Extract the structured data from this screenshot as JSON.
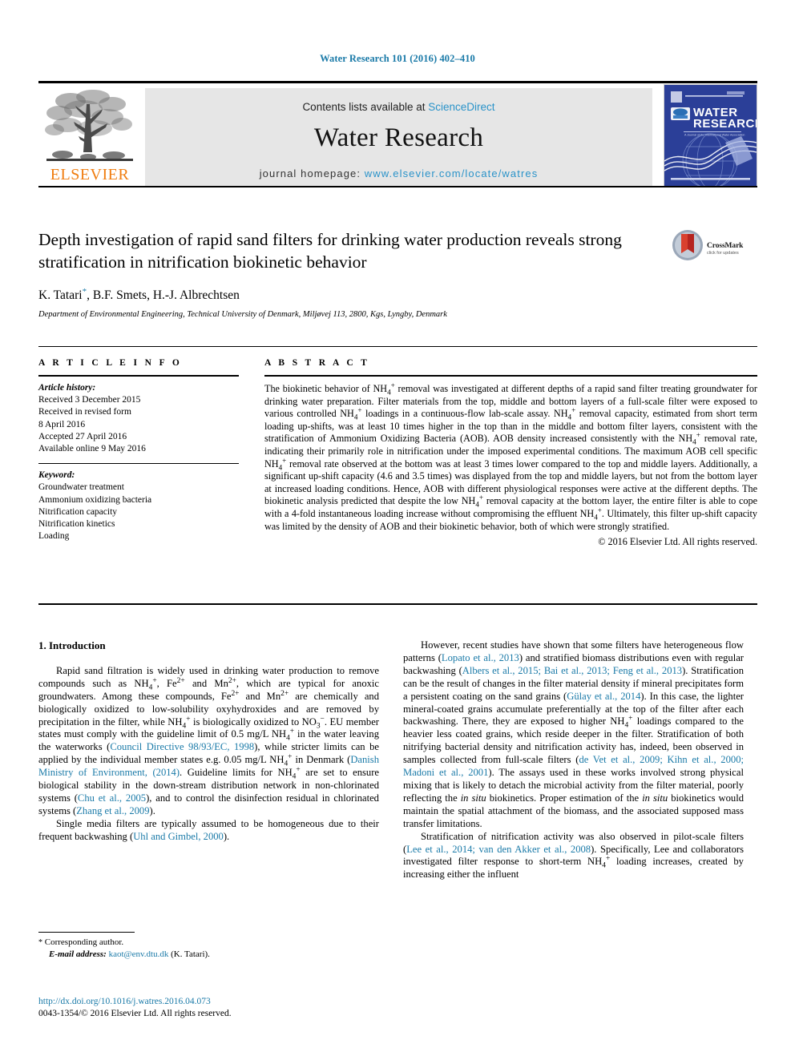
{
  "running_head": "Water Research 101 (2016) 402–410",
  "masthead": {
    "publisher_logo_name": "elsevier-tree-logo",
    "publisher_wordmark": "ELSEVIER",
    "contents_prefix": "Contents lists available at ",
    "contents_link": "ScienceDirect",
    "journal_title": "Water Research",
    "homepage_prefix": "journal homepage: ",
    "homepage_url": "www.elsevier.com/locate/watres",
    "cover_title_line1": "WATER",
    "cover_title_line2": "RESEARCH",
    "cover_bg": "#2b3f98",
    "band_bg": "#e6e6e6",
    "link_color": "#2a93c9"
  },
  "article": {
    "title": "Depth investigation of rapid sand filters for drinking water production reveals strong stratification in nitrification biokinetic behavior",
    "authors": "K. Tatari",
    "authors_rest": ", B.F. Smets, H.-J. Albrechtsen",
    "corresponding_marker": "*",
    "affiliation": "Department of Environmental Engineering, Technical University of Denmark, Miljøvej 113, 2800, Kgs, Lyngby, Denmark",
    "crossmark_label": "CrossMark",
    "crossmark_sub": "click for updates"
  },
  "article_info": {
    "heading": "A R T I C L E   I N F O",
    "history_heading": "Article history:",
    "history_lines": [
      "Received 3 December 2015",
      "Received in revised form",
      "8 April 2016",
      "Accepted 27 April 2016",
      "Available online 9 May 2016"
    ],
    "keyword_heading": "Keyword:",
    "keywords": [
      "Groundwater treatment",
      "Ammonium oxidizing bacteria",
      "Nitrification capacity",
      "Nitrification kinetics",
      "Loading"
    ]
  },
  "abstract": {
    "heading": "A B S T R A C T",
    "paragraph_html": "The biokinetic behavior of NH<sub>4</sub><sup>+</sup> removal was investigated at different depths of a rapid sand filter treating groundwater for drinking water preparation. Filter materials from the top, middle and bottom layers of a full-scale filter were exposed to various controlled NH<sub>4</sub><sup>+</sup> loadings in a continuous-flow lab-scale assay. NH<sub>4</sub><sup>+</sup> removal capacity, estimated from short term loading up-shifts, was at least 10 times higher in the top than in the middle and bottom filter layers, consistent with the stratification of Ammonium Oxidizing Bacteria (AOB). AOB density increased consistently with the NH<sub>4</sub><sup>+</sup> removal rate, indicating their primarily role in nitrification under the imposed experimental conditions. The maximum AOB cell specific NH<sub>4</sub><sup>+</sup> removal rate observed at the bottom was at least 3 times lower compared to the top and middle layers. Additionally, a significant up-shift capacity (4.6 and 3.5 times) was displayed from the top and middle layers, but not from the bottom layer at increased loading conditions. Hence, AOB with different physiological responses were active at the different depths. The biokinetic analysis predicted that despite the low NH<sub>4</sub><sup>+</sup> removal capacity at the bottom layer, the entire filter is able to cope with a 4-fold instantaneous loading increase without compromising the effluent NH<sub>4</sub><sup>+</sup>. Ultimately, this filter up-shift capacity was limited by the density of AOB and their biokinetic behavior, both of which were strongly stratified.",
    "copyright": "© 2016 Elsevier Ltd. All rights reserved."
  },
  "body": {
    "section_number_title": "1.  Introduction",
    "left_paragraphs_html": [
      "Rapid sand filtration is widely used in drinking water production to remove compounds such as NH<sub>4</sub><sup>+</sup>, Fe<sup>2+</sup> and Mn<sup>2+</sup>, which are typical for anoxic groundwaters. Among these compounds, Fe<sup>2+</sup> and Mn<sup>2+</sup> are chemically and biologically oxidized to low-solubility oxyhydroxides and are removed by precipitation in the filter, while NH<sub>4</sub><sup>+</sup> is biologically oxidized to NO<sub>3</sub><sup>−</sup>. EU member states must comply with the guideline limit of 0.5 mg/L NH<sub>4</sub><sup>+</sup> in the water leaving the waterworks (<span class=\"cite\">Council Directive 98/93/EC, 1998</span>), while stricter limits can be applied by the individual member states e.g. 0.05 mg/L NH<sub>4</sub><sup>+</sup> in Denmark (<span class=\"cite\">Danish Ministry of Environment, (2014)</span>. Guideline limits for NH<sub>4</sub><sup>+</sup> are set to ensure biological stability in the down-stream distribution network in non-chlorinated systems (<span class=\"cite\">Chu et al., 2005</span>), and to control the disinfection residual in chlorinated systems (<span class=\"cite\">Zhang et al., 2009</span>).",
      "Single media filters are typically assumed to be homogeneous due to their frequent backwashing (<span class=\"cite\">Uhl and Gimbel, 2000</span>)."
    ],
    "right_paragraphs_html": [
      "However, recent studies have shown that some filters have heterogeneous flow patterns (<span class=\"cite\">Lopato et al., 2013</span>) and stratified biomass distributions even with regular backwashing (<span class=\"cite\">Albers et al., 2015; Bai et al., 2013; Feng et al., 2013</span>). Stratification can be the result of changes in the filter material density if mineral precipitates form a persistent coating on the sand grains (<span class=\"cite\">Gülay et al., 2014</span>). In this case, the lighter mineral-coated grains accumulate preferentially at the top of the filter after each backwashing. There, they are exposed to higher NH<sub>4</sub><sup>+</sup> loadings compared to the heavier less coated grains, which reside deeper in the filter. Stratification of both nitrifying bacterial density and nitrification activity has, indeed, been observed in samples collected from full-scale filters (<span class=\"cite\">de Vet et al., 2009; Kihn et al., 2000; Madoni et al., 2001</span>). The assays used in these works involved strong physical mixing that is likely to detach the microbial activity from the filter material, poorly reflecting the <i>in situ</i> biokinetics. Proper estimation of the <i>in situ</i> biokinetics would maintain the spatial attachment of the biomass, and the associated supposed mass transfer limitations.",
      "Stratification of nitrification activity was also observed in pilot-scale filters (<span class=\"cite\">Lee et al., 2014; van den Akker et al., 2008</span>). Specifically, Lee and collaborators investigated filter response to short-term NH<sub>4</sub><sup>+</sup> loading increases, created by increasing either the influent"
    ]
  },
  "footnote": {
    "corresponding_author": "Corresponding author.",
    "email_label": "E-mail address:",
    "email": "kaot@env.dtu.dk",
    "email_owner": "(K. Tatari)."
  },
  "footer": {
    "doi": "http://dx.doi.org/10.1016/j.watres.2016.04.073",
    "issn_line": "0043-1354/© 2016 Elsevier Ltd. All rights reserved."
  },
  "colors": {
    "link_blue": "#1a7aa8",
    "sd_blue": "#2a93c9",
    "elsevier_orange": "#f07d10",
    "cover_blue": "#2b3f98"
  }
}
